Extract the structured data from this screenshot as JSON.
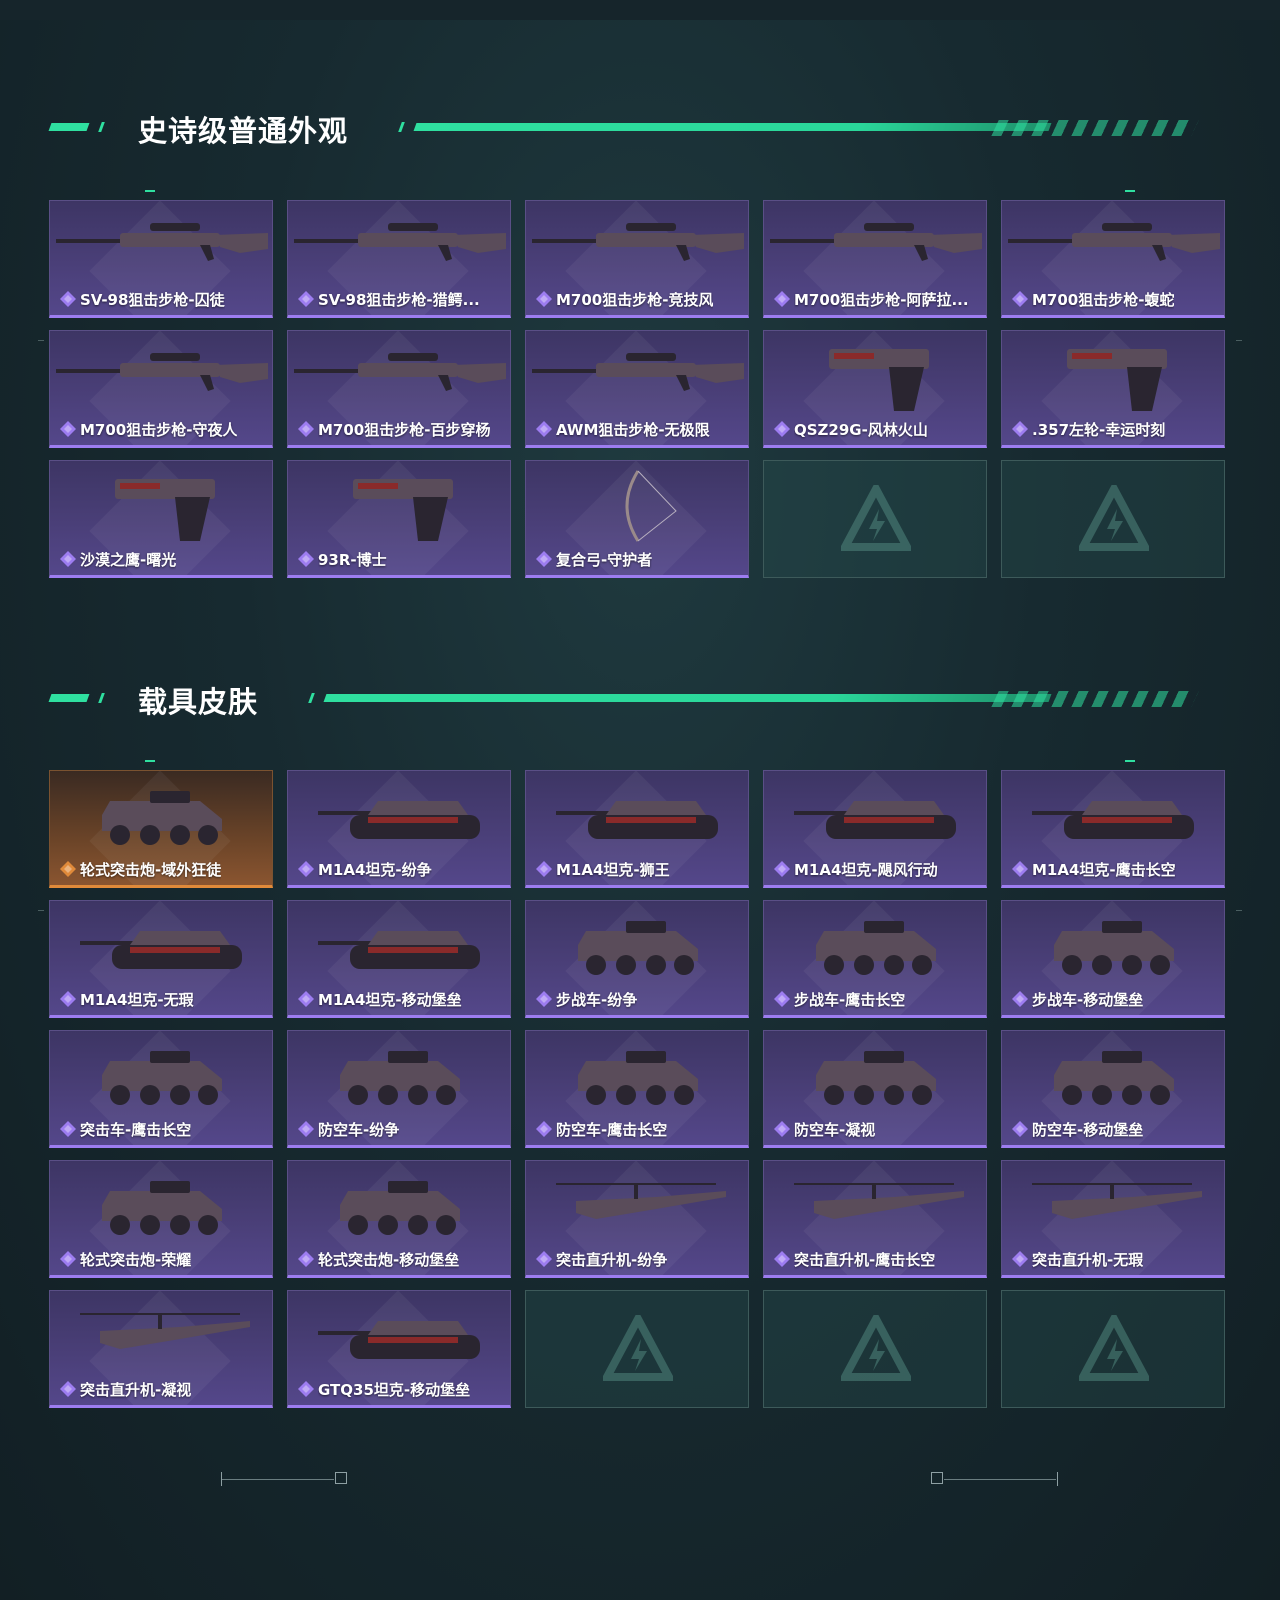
{
  "colors": {
    "accent": "#2fe0a0",
    "epic_purple": "#9d7df0",
    "legendary_orange": "#e08a3a",
    "tile_purple": "#4a3f78"
  },
  "sections": [
    {
      "title": "史诗级普通外观",
      "items": [
        {
          "name": "SV-98狙击步枪-囚徒",
          "rarity": "epic",
          "icon": "sniper-rifle-icon"
        },
        {
          "name": "SV-98狙击步枪-猎鳄...",
          "rarity": "epic",
          "icon": "sniper-rifle-icon"
        },
        {
          "name": "M700狙击步枪-竞技风",
          "rarity": "epic",
          "icon": "sniper-rifle-icon"
        },
        {
          "name": "M700狙击步枪-阿萨拉...",
          "rarity": "epic",
          "icon": "sniper-rifle-icon"
        },
        {
          "name": "M700狙击步枪-蝮蛇",
          "rarity": "epic",
          "icon": "sniper-rifle-icon"
        },
        {
          "name": "M700狙击步枪-守夜人",
          "rarity": "epic",
          "icon": "sniper-rifle-icon"
        },
        {
          "name": "M700狙击步枪-百步穿杨",
          "rarity": "epic",
          "icon": "sniper-rifle-icon"
        },
        {
          "name": "AWM狙击步枪-无极限",
          "rarity": "epic",
          "icon": "sniper-rifle-icon"
        },
        {
          "name": "QSZ29G-风林火山",
          "rarity": "epic",
          "icon": "pistol-icon"
        },
        {
          "name": ".357左轮-幸运时刻",
          "rarity": "epic",
          "icon": "revolver-icon"
        },
        {
          "name": "沙漠之鹰-曙光",
          "rarity": "epic",
          "icon": "pistol-icon"
        },
        {
          "name": "93R-博士",
          "rarity": "epic",
          "icon": "pistol-icon"
        },
        {
          "name": "复合弓-守护者",
          "rarity": "epic",
          "icon": "compound-bow-icon"
        }
      ],
      "empty_slots": 2
    },
    {
      "title": "载具皮肤",
      "items": [
        {
          "name": "轮式突击炮-域外狂徒",
          "rarity": "legendary",
          "icon": "armored-car-icon"
        },
        {
          "name": "M1A4坦克-纷争",
          "rarity": "epic",
          "icon": "tank-icon"
        },
        {
          "name": "M1A4坦克-狮王",
          "rarity": "epic",
          "icon": "tank-icon"
        },
        {
          "name": "M1A4坦克-飓风行动",
          "rarity": "epic",
          "icon": "tank-icon"
        },
        {
          "name": "M1A4坦克-鹰击长空",
          "rarity": "epic",
          "icon": "tank-icon"
        },
        {
          "name": "M1A4坦克-无瑕",
          "rarity": "epic",
          "icon": "tank-icon"
        },
        {
          "name": "M1A4坦克-移动堡垒",
          "rarity": "epic",
          "icon": "tank-icon"
        },
        {
          "name": "步战车-纷争",
          "rarity": "epic",
          "icon": "ifv-icon"
        },
        {
          "name": "步战车-鹰击长空",
          "rarity": "epic",
          "icon": "ifv-icon"
        },
        {
          "name": "步战车-移动堡垒",
          "rarity": "epic",
          "icon": "ifv-icon"
        },
        {
          "name": "突击车-鹰击长空",
          "rarity": "epic",
          "icon": "assault-vehicle-icon"
        },
        {
          "name": "防空车-纷争",
          "rarity": "epic",
          "icon": "ifv-icon"
        },
        {
          "name": "防空车-鹰击长空",
          "rarity": "epic",
          "icon": "ifv-icon"
        },
        {
          "name": "防空车-凝视",
          "rarity": "epic",
          "icon": "ifv-icon"
        },
        {
          "name": "防空车-移动堡垒",
          "rarity": "epic",
          "icon": "ifv-icon"
        },
        {
          "name": "轮式突击炮-荣耀",
          "rarity": "epic",
          "icon": "armored-car-icon"
        },
        {
          "name": "轮式突击炮-移动堡垒",
          "rarity": "epic",
          "icon": "armored-car-icon"
        },
        {
          "name": "突击直升机-纷争",
          "rarity": "epic",
          "icon": "helicopter-icon"
        },
        {
          "name": "突击直升机-鹰击长空",
          "rarity": "epic",
          "icon": "helicopter-icon"
        },
        {
          "name": "突击直升机-无瑕",
          "rarity": "epic",
          "icon": "helicopter-icon"
        },
        {
          "name": "突击直升机-凝视",
          "rarity": "epic",
          "icon": "helicopter-icon"
        },
        {
          "name": "GTQ35坦克-移动堡垒",
          "rarity": "epic",
          "icon": "tank-icon"
        }
      ],
      "empty_slots": 3
    }
  ]
}
